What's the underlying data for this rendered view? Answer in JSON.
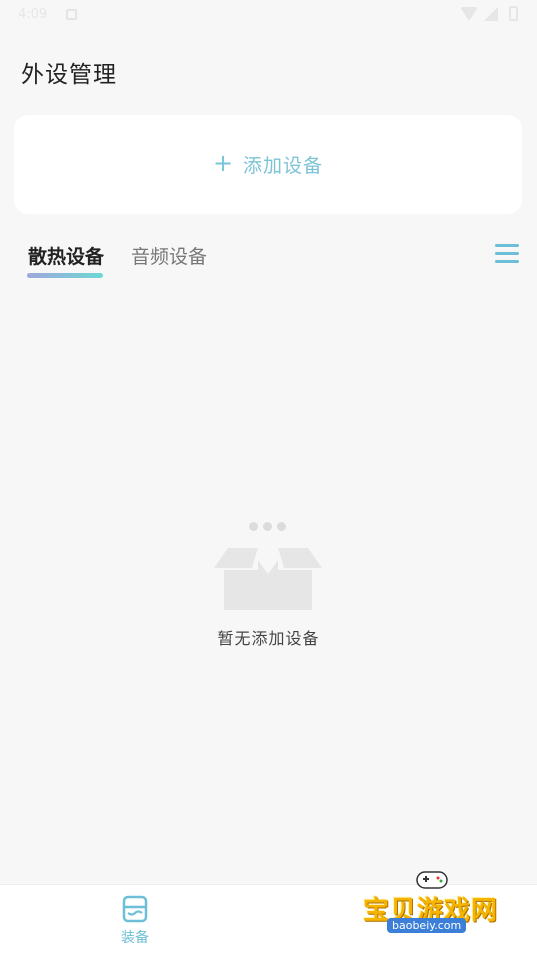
{
  "status_bar": {
    "time": "4:09"
  },
  "header": {
    "title": "外设管理"
  },
  "add_device": {
    "plus": "+",
    "label": "添加设备"
  },
  "tabs": [
    {
      "label": "散热设备",
      "active": true
    },
    {
      "label": "音频设备",
      "active": false
    }
  ],
  "empty_state": {
    "message": "暂无添加设备"
  },
  "bottom_nav": {
    "items": [
      {
        "label": "装备",
        "icon": "equipment-icon",
        "active": true
      }
    ]
  },
  "watermark": {
    "text": "宝贝游戏网",
    "url": "baobeiy.com"
  },
  "colors": {
    "accent": "#6cbfd6",
    "background": "#f7f7f7",
    "card": "#ffffff",
    "title": "#222222"
  }
}
